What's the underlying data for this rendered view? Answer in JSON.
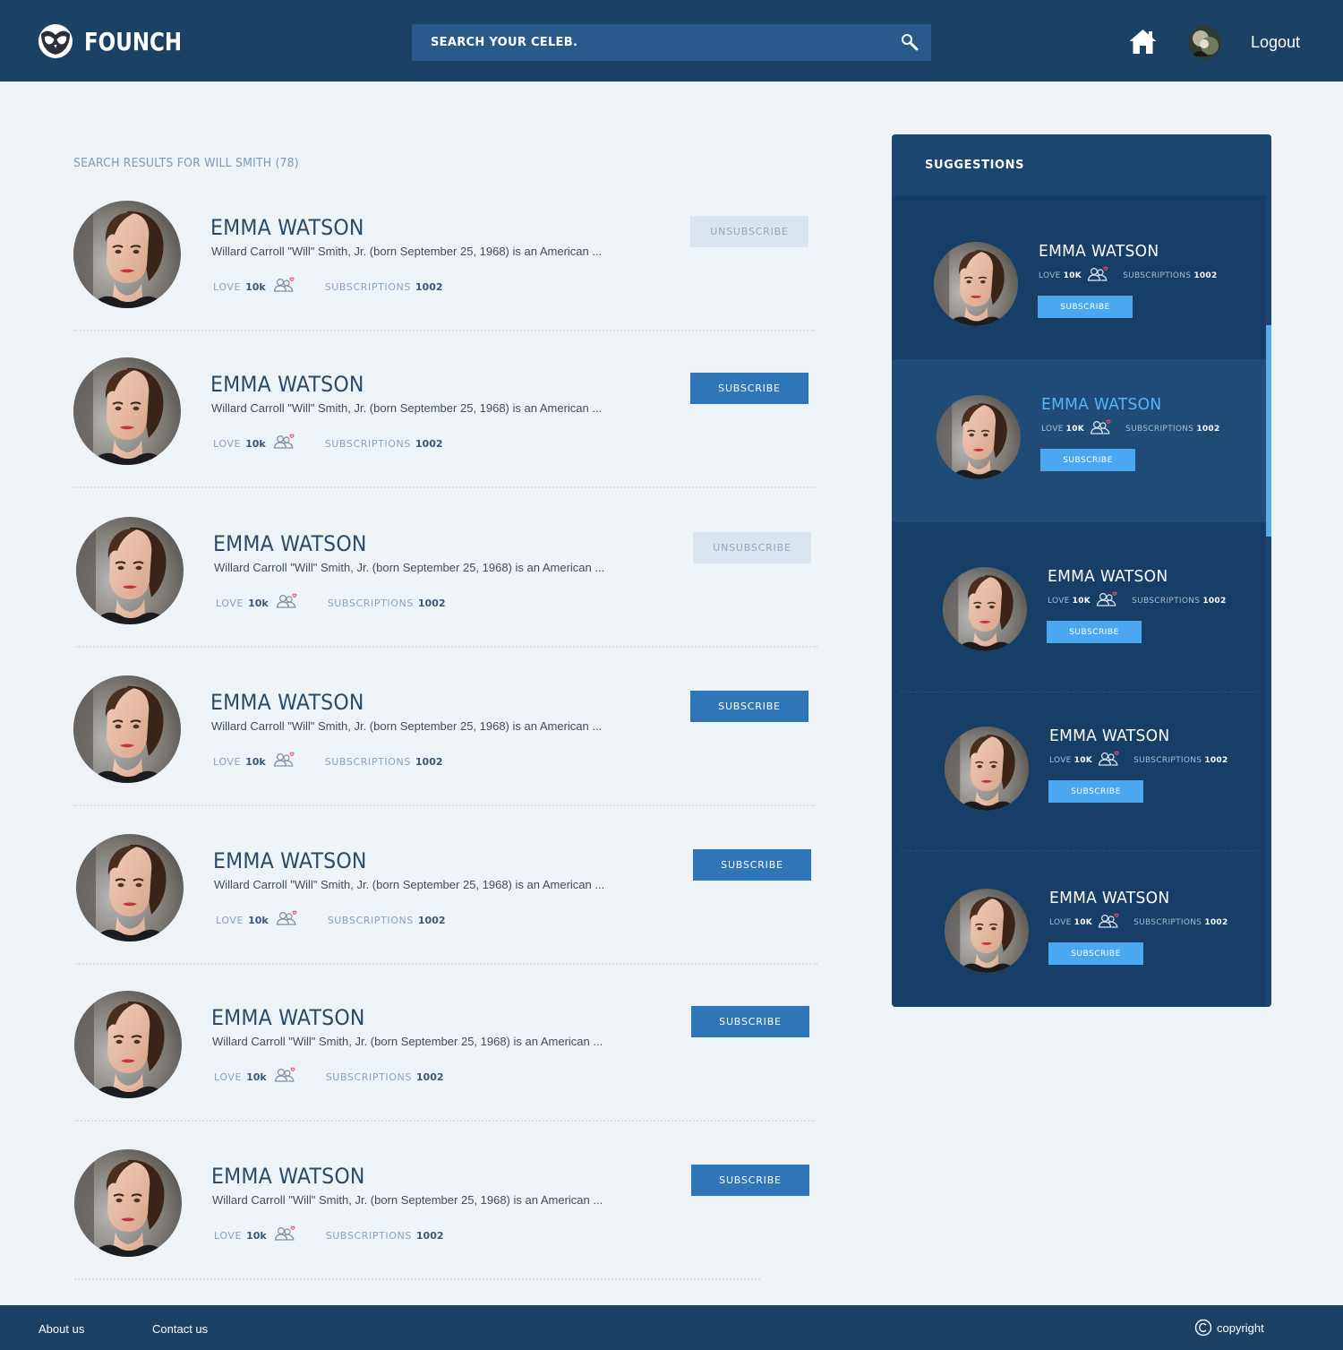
{
  "header": {
    "brand": "FOUNCH",
    "search_placeholder": "SEARCH YOUR CELEB.",
    "logout": "Logout"
  },
  "results": {
    "heading": "SEARCH RESULTS FOR WILL SMITH (78)",
    "items": [
      {
        "name": "EMMA WATSON",
        "bio": "Willard Carroll \"Will\" Smith, Jr. (born September 25, 1968) is an American ...",
        "love_label": "LOVE",
        "love": "10k",
        "subs_label": "SUBSCRIPTIONS",
        "subs": "1002",
        "button": "UNSUBSCRIBE"
      },
      {
        "name": "EMMA WATSON",
        "bio": "Willard Carroll \"Will\" Smith, Jr. (born September 25, 1968) is an American ...",
        "love_label": "LOVE",
        "love": "10k",
        "subs_label": "SUBSCRIPTIONS",
        "subs": "1002",
        "button": "SUBSCRIBE"
      },
      {
        "name": "EMMA WATSON",
        "bio": "Willard Carroll \"Will\" Smith, Jr. (born September 25, 1968) is an American ...",
        "love_label": "LOVE",
        "love": "10k",
        "subs_label": "SUBSCRIPTIONS",
        "subs": "1002",
        "button": "UNSUBSCRIBE"
      },
      {
        "name": "EMMA WATSON",
        "bio": "Willard Carroll \"Will\" Smith, Jr. (born September 25, 1968) is an American ...",
        "love_label": "LOVE",
        "love": "10k",
        "subs_label": "SUBSCRIPTIONS",
        "subs": "1002",
        "button": "SUBSCRIBE"
      },
      {
        "name": "EMMA WATSON",
        "bio": "Willard Carroll \"Will\" Smith, Jr. (born September 25, 1968) is an American ...",
        "love_label": "LOVE",
        "love": "10k",
        "subs_label": "SUBSCRIPTIONS",
        "subs": "1002",
        "button": "SUBSCRIBE"
      },
      {
        "name": "EMMA WATSON",
        "bio": "Willard Carroll \"Will\" Smith, Jr. (born September 25, 1968) is an American ...",
        "love_label": "LOVE",
        "love": "10k",
        "subs_label": "SUBSCRIPTIONS",
        "subs": "1002",
        "button": "SUBSCRIBE"
      },
      {
        "name": "EMMA WATSON",
        "bio": "Willard Carroll \"Will\" Smith, Jr. (born September 25, 1968) is an American ...",
        "love_label": "LOVE",
        "love": "10k",
        "subs_label": "SUBSCRIPTIONS",
        "subs": "1002",
        "button": "SUBSCRIBE"
      }
    ]
  },
  "suggestions": {
    "title": "SUGGESTIONS",
    "items": [
      {
        "name": "EMMA WATSON",
        "love_label": "LOVE",
        "love": "10K",
        "subs_label": "SUBSCRIPTIONS",
        "subs": "1002",
        "button": "SUBSCRIBE"
      },
      {
        "name": "EMMA WATSON",
        "love_label": "LOVE",
        "love": "10K",
        "subs_label": "SUBSCRIPTIONS",
        "subs": "1002",
        "button": "SUBSCRIBE"
      },
      {
        "name": "EMMA WATSON",
        "love_label": "LOVE",
        "love": "10K",
        "subs_label": "SUBSCRIPTIONS",
        "subs": "1002",
        "button": "SUBSCRIBE"
      },
      {
        "name": "EMMA WATSON",
        "love_label": "LOVE",
        "love": "10K",
        "subs_label": "SUBSCRIPTIONS",
        "subs": "1002",
        "button": "SUBSCRIBE"
      },
      {
        "name": "EMMA WATSON",
        "love_label": "LOVE",
        "love": "10K",
        "subs_label": "SUBSCRIPTIONS",
        "subs": "1002",
        "button": "SUBSCRIBE"
      }
    ]
  },
  "footer": {
    "about": "About us",
    "contact": "Contact us",
    "copyright": "copyright"
  },
  "colors": {
    "header_bg": "#1b4264",
    "page_bg": "#eef3f8",
    "subscribe": "#2f76b9",
    "unsubscribe": "#dbe5ef",
    "panel_bg": "#173e66",
    "suggestion_button": "#4ba8f0",
    "active_name": "#5bb4f7"
  },
  "icons": [
    "owl-logo-icon",
    "search-icon",
    "home-icon",
    "people-heart-icon",
    "copyright-icon"
  ]
}
